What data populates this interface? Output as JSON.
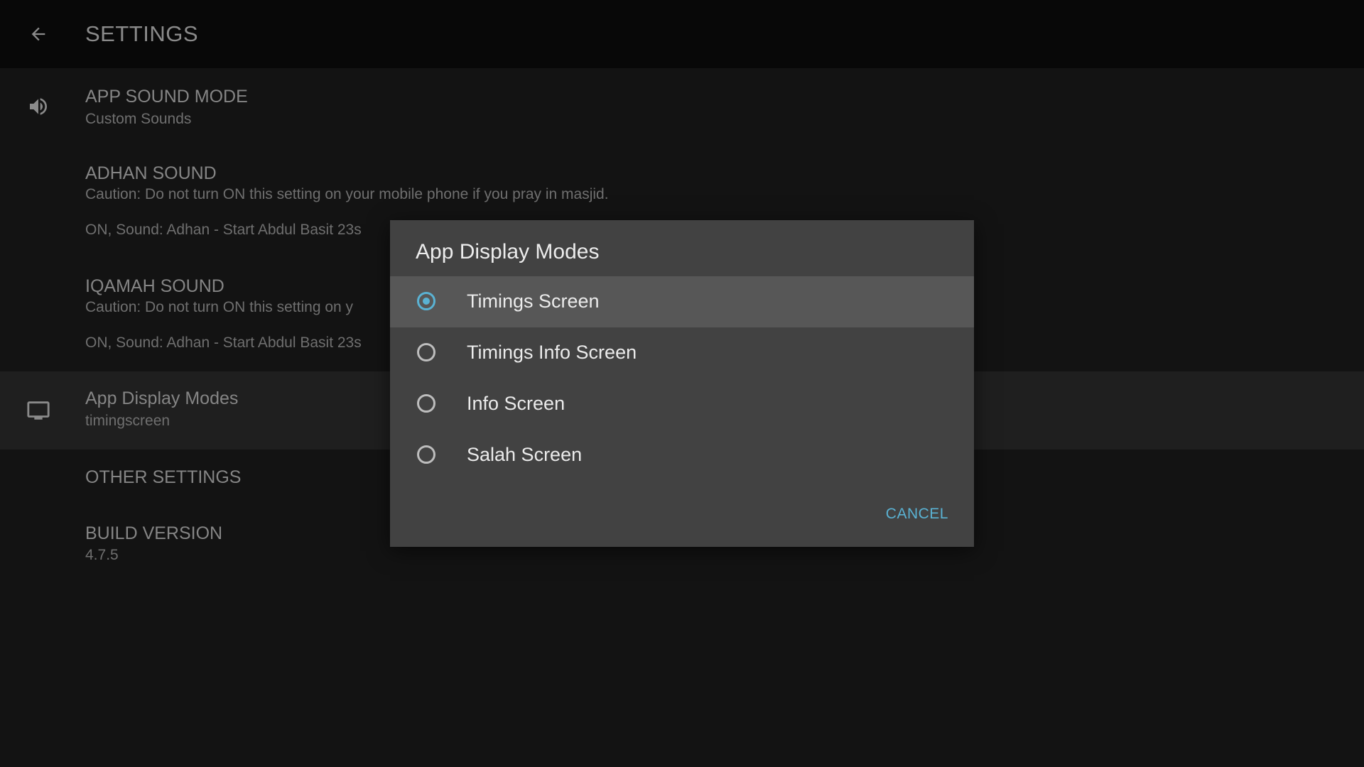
{
  "header": {
    "title": "SETTINGS",
    "back_icon": "back-arrow-icon"
  },
  "settings": {
    "app_sound_mode": {
      "title": "APP SOUND MODE",
      "subtitle": "Custom Sounds",
      "icon": "speaker-icon"
    },
    "adhan_sound": {
      "title": "ADHAN SOUND",
      "caution": "Caution: Do not turn ON this setting on your mobile phone if you pray in masjid.",
      "value": "ON, Sound: Adhan - Start Abdul Basit 23s"
    },
    "iqamah_sound": {
      "title": "IQAMAH SOUND",
      "caution": "Caution: Do not turn ON this setting on y",
      "value": "ON, Sound: Adhan - Start Abdul Basit 23s"
    },
    "app_display_modes": {
      "title": "App Display Modes",
      "subtitle": "timingscreen",
      "icon": "monitor-icon"
    },
    "other_settings": {
      "title": "OTHER SETTINGS"
    },
    "build_version": {
      "title": "BUILD VERSION",
      "subtitle": "4.7.5"
    }
  },
  "dialog": {
    "title": "App Display Modes",
    "options": [
      {
        "label": "Timings Screen",
        "selected": true
      },
      {
        "label": "Timings Info Screen",
        "selected": false
      },
      {
        "label": "Info Screen",
        "selected": false
      },
      {
        "label": "Salah Screen",
        "selected": false
      }
    ],
    "cancel_label": "CANCEL"
  },
  "colors": {
    "accent": "#5ab2d3",
    "dialog_bg": "#424242",
    "selected_row": "#575757",
    "page_bg": "#131313"
  }
}
